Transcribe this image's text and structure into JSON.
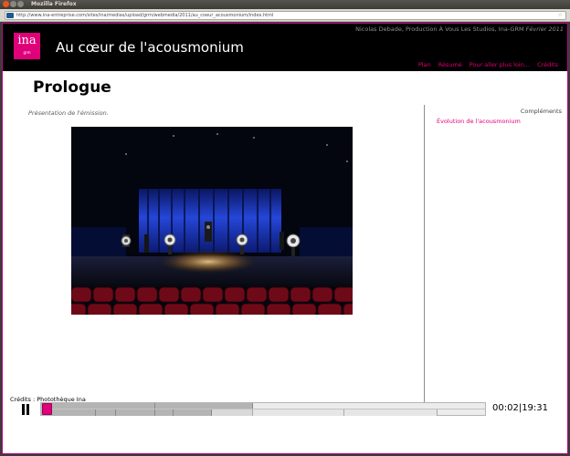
{
  "window": {
    "title": "Mozilla Firefox",
    "url": "http://www.ina-entreprise.com/sites/ina/medias/upload/grm/webmedia/2011/au_coeur_acousmonium/index.html"
  },
  "header": {
    "logo_text": "ina",
    "logo_sub": "grm",
    "site_title": "Au cœur de l'acousmonium",
    "byline": "Nicolas Debade, Production À Vous Les Studios, Ina-GRM",
    "date": "Février 2011",
    "nav": [
      "Plan",
      "Résumé",
      "Pour aller plus loin...",
      "Crédits"
    ]
  },
  "main": {
    "title": "Prologue",
    "description": "Présentation de l'émission.",
    "credits": "Crédits : Photothèque Ina"
  },
  "sidebar": {
    "title": "Compléments",
    "links": [
      "Évolution de l'acousmonium"
    ]
  },
  "player": {
    "current_time": "00:02",
    "total_time": "19:31",
    "time_display": "00:02|19:31",
    "progress_fraction": 0.0017
  },
  "colors": {
    "accent": "#e0007a",
    "header_bg": "#000000"
  }
}
